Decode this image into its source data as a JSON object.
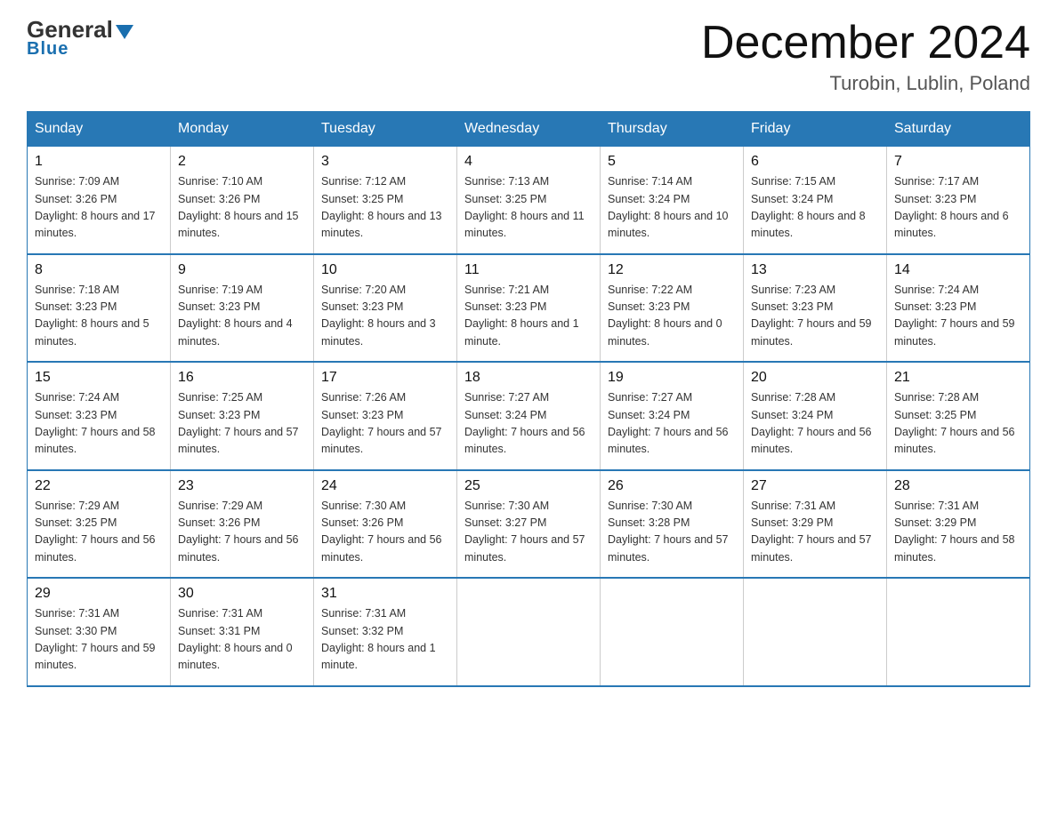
{
  "header": {
    "logo_general": "General",
    "logo_blue": "Blue",
    "month_year": "December 2024",
    "location": "Turobin, Lublin, Poland"
  },
  "days_of_week": [
    "Sunday",
    "Monday",
    "Tuesday",
    "Wednesday",
    "Thursday",
    "Friday",
    "Saturday"
  ],
  "weeks": [
    [
      {
        "day": "1",
        "sunrise": "Sunrise: 7:09 AM",
        "sunset": "Sunset: 3:26 PM",
        "daylight": "Daylight: 8 hours and 17 minutes."
      },
      {
        "day": "2",
        "sunrise": "Sunrise: 7:10 AM",
        "sunset": "Sunset: 3:26 PM",
        "daylight": "Daylight: 8 hours and 15 minutes."
      },
      {
        "day": "3",
        "sunrise": "Sunrise: 7:12 AM",
        "sunset": "Sunset: 3:25 PM",
        "daylight": "Daylight: 8 hours and 13 minutes."
      },
      {
        "day": "4",
        "sunrise": "Sunrise: 7:13 AM",
        "sunset": "Sunset: 3:25 PM",
        "daylight": "Daylight: 8 hours and 11 minutes."
      },
      {
        "day": "5",
        "sunrise": "Sunrise: 7:14 AM",
        "sunset": "Sunset: 3:24 PM",
        "daylight": "Daylight: 8 hours and 10 minutes."
      },
      {
        "day": "6",
        "sunrise": "Sunrise: 7:15 AM",
        "sunset": "Sunset: 3:24 PM",
        "daylight": "Daylight: 8 hours and 8 minutes."
      },
      {
        "day": "7",
        "sunrise": "Sunrise: 7:17 AM",
        "sunset": "Sunset: 3:23 PM",
        "daylight": "Daylight: 8 hours and 6 minutes."
      }
    ],
    [
      {
        "day": "8",
        "sunrise": "Sunrise: 7:18 AM",
        "sunset": "Sunset: 3:23 PM",
        "daylight": "Daylight: 8 hours and 5 minutes."
      },
      {
        "day": "9",
        "sunrise": "Sunrise: 7:19 AM",
        "sunset": "Sunset: 3:23 PM",
        "daylight": "Daylight: 8 hours and 4 minutes."
      },
      {
        "day": "10",
        "sunrise": "Sunrise: 7:20 AM",
        "sunset": "Sunset: 3:23 PM",
        "daylight": "Daylight: 8 hours and 3 minutes."
      },
      {
        "day": "11",
        "sunrise": "Sunrise: 7:21 AM",
        "sunset": "Sunset: 3:23 PM",
        "daylight": "Daylight: 8 hours and 1 minute."
      },
      {
        "day": "12",
        "sunrise": "Sunrise: 7:22 AM",
        "sunset": "Sunset: 3:23 PM",
        "daylight": "Daylight: 8 hours and 0 minutes."
      },
      {
        "day": "13",
        "sunrise": "Sunrise: 7:23 AM",
        "sunset": "Sunset: 3:23 PM",
        "daylight": "Daylight: 7 hours and 59 minutes."
      },
      {
        "day": "14",
        "sunrise": "Sunrise: 7:24 AM",
        "sunset": "Sunset: 3:23 PM",
        "daylight": "Daylight: 7 hours and 59 minutes."
      }
    ],
    [
      {
        "day": "15",
        "sunrise": "Sunrise: 7:24 AM",
        "sunset": "Sunset: 3:23 PM",
        "daylight": "Daylight: 7 hours and 58 minutes."
      },
      {
        "day": "16",
        "sunrise": "Sunrise: 7:25 AM",
        "sunset": "Sunset: 3:23 PM",
        "daylight": "Daylight: 7 hours and 57 minutes."
      },
      {
        "day": "17",
        "sunrise": "Sunrise: 7:26 AM",
        "sunset": "Sunset: 3:23 PM",
        "daylight": "Daylight: 7 hours and 57 minutes."
      },
      {
        "day": "18",
        "sunrise": "Sunrise: 7:27 AM",
        "sunset": "Sunset: 3:24 PM",
        "daylight": "Daylight: 7 hours and 56 minutes."
      },
      {
        "day": "19",
        "sunrise": "Sunrise: 7:27 AM",
        "sunset": "Sunset: 3:24 PM",
        "daylight": "Daylight: 7 hours and 56 minutes."
      },
      {
        "day": "20",
        "sunrise": "Sunrise: 7:28 AM",
        "sunset": "Sunset: 3:24 PM",
        "daylight": "Daylight: 7 hours and 56 minutes."
      },
      {
        "day": "21",
        "sunrise": "Sunrise: 7:28 AM",
        "sunset": "Sunset: 3:25 PM",
        "daylight": "Daylight: 7 hours and 56 minutes."
      }
    ],
    [
      {
        "day": "22",
        "sunrise": "Sunrise: 7:29 AM",
        "sunset": "Sunset: 3:25 PM",
        "daylight": "Daylight: 7 hours and 56 minutes."
      },
      {
        "day": "23",
        "sunrise": "Sunrise: 7:29 AM",
        "sunset": "Sunset: 3:26 PM",
        "daylight": "Daylight: 7 hours and 56 minutes."
      },
      {
        "day": "24",
        "sunrise": "Sunrise: 7:30 AM",
        "sunset": "Sunset: 3:26 PM",
        "daylight": "Daylight: 7 hours and 56 minutes."
      },
      {
        "day": "25",
        "sunrise": "Sunrise: 7:30 AM",
        "sunset": "Sunset: 3:27 PM",
        "daylight": "Daylight: 7 hours and 57 minutes."
      },
      {
        "day": "26",
        "sunrise": "Sunrise: 7:30 AM",
        "sunset": "Sunset: 3:28 PM",
        "daylight": "Daylight: 7 hours and 57 minutes."
      },
      {
        "day": "27",
        "sunrise": "Sunrise: 7:31 AM",
        "sunset": "Sunset: 3:29 PM",
        "daylight": "Daylight: 7 hours and 57 minutes."
      },
      {
        "day": "28",
        "sunrise": "Sunrise: 7:31 AM",
        "sunset": "Sunset: 3:29 PM",
        "daylight": "Daylight: 7 hours and 58 minutes."
      }
    ],
    [
      {
        "day": "29",
        "sunrise": "Sunrise: 7:31 AM",
        "sunset": "Sunset: 3:30 PM",
        "daylight": "Daylight: 7 hours and 59 minutes."
      },
      {
        "day": "30",
        "sunrise": "Sunrise: 7:31 AM",
        "sunset": "Sunset: 3:31 PM",
        "daylight": "Daylight: 8 hours and 0 minutes."
      },
      {
        "day": "31",
        "sunrise": "Sunrise: 7:31 AM",
        "sunset": "Sunset: 3:32 PM",
        "daylight": "Daylight: 8 hours and 1 minute."
      },
      null,
      null,
      null,
      null
    ]
  ]
}
